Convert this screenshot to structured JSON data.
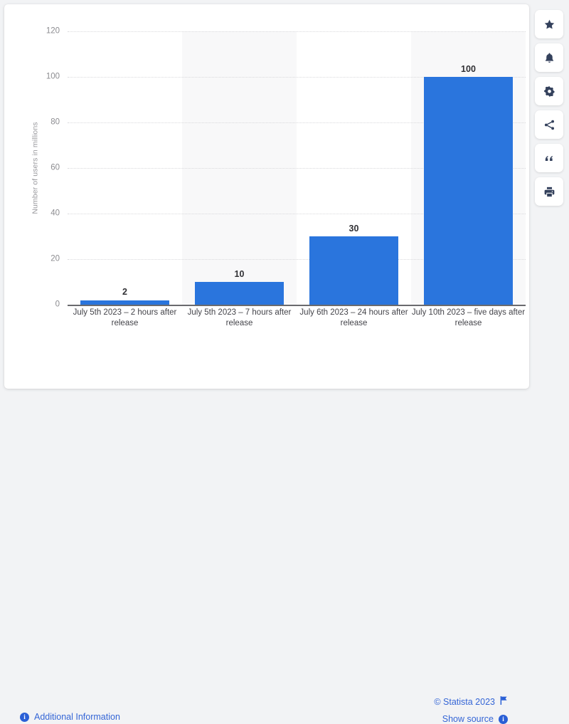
{
  "chart_data": {
    "type": "bar",
    "title": "",
    "subtitle": "",
    "xlabel": "",
    "ylabel": "Number of users in millions",
    "ylim": [
      0,
      120
    ],
    "yticks": [
      0,
      20,
      40,
      60,
      80,
      100,
      120
    ],
    "grid": true,
    "legend": false,
    "categories": [
      "July 5th 2023 – 2 hours after release",
      "July 5th 2023 – 7 hours after release",
      "July 6th 2023 – 24 hours after release",
      "July 10th 2023 – five days after release"
    ],
    "values": [
      2,
      10,
      30,
      100
    ],
    "value_labels": [
      "2",
      "10",
      "30",
      "100"
    ],
    "series": [
      {
        "name": "Number of users in millions",
        "values": [
          2,
          10,
          30,
          100
        ]
      }
    ],
    "bar_color": "#2a75dd",
    "band_color": "#f8f8f9"
  },
  "footer": {
    "additional_information": "Additional Information",
    "copyright": "© Statista 2023",
    "show_source": "Show source",
    "info_glyph": "i",
    "link_color": "#3465d6"
  },
  "toolbar": {
    "items": [
      {
        "name": "favorite-icon",
        "label": "Favorite"
      },
      {
        "name": "notification-icon",
        "label": "Notifications"
      },
      {
        "name": "settings-icon",
        "label": "Settings"
      },
      {
        "name": "share-icon",
        "label": "Share"
      },
      {
        "name": "citation-icon",
        "label": "Cite"
      },
      {
        "name": "print-icon",
        "label": "Print"
      }
    ]
  }
}
